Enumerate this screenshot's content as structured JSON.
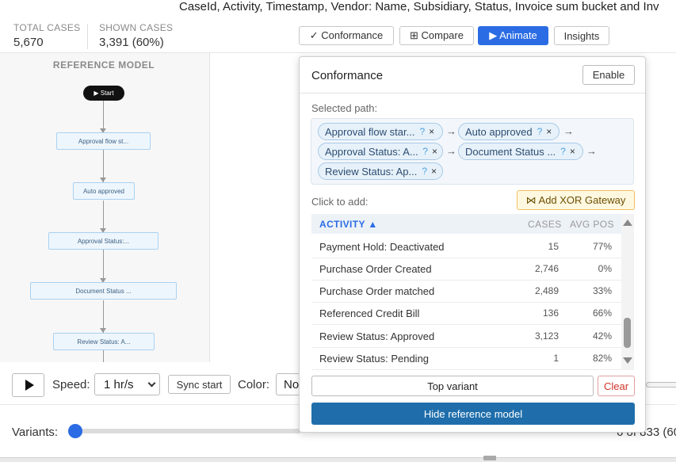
{
  "header": {
    "title": "CaseId, Activity, Timestamp, Vendor: Name, Subsidiary, Status, Invoice sum bucket and Inv",
    "total_cases_label": "TOTAL CASES",
    "total_cases_value": "5,670",
    "shown_cases_label": "SHOWN CASES",
    "shown_cases_value": "3,391 (60%)"
  },
  "toolbar": {
    "conformance_label": "✓ Conformance",
    "compare_label": "⊞ Compare",
    "animate_label": "▶ Animate",
    "insights_label": "Insights"
  },
  "reference_model": {
    "title": "REFERENCE MODEL",
    "start_label": "▶ Start",
    "nodes": [
      "Approval flow st...",
      "Auto approved",
      "Approval Status:...",
      "Document Status ...",
      "Review Status: A..."
    ]
  },
  "conformance": {
    "title": "Conformance",
    "enable_label": "Enable",
    "selected_path_label": "Selected path:",
    "chips": [
      "Approval flow star...",
      "Auto approved",
      "Approval Status: A...",
      "Document Status ...",
      "Review Status: Ap..."
    ],
    "chip_q": "?",
    "chip_x": "×",
    "arrow": "→",
    "click_to_add_label": "Click to add:",
    "xor_label": "⋈ Add XOR Gateway",
    "table": {
      "col_activity": "ACTIVITY ▲",
      "col_cases": "CASES",
      "col_avg_pos": "AVG POS",
      "rows": [
        {
          "name": "Payment Hold: Deactivated",
          "cases": "15",
          "avg": "77%"
        },
        {
          "name": "Purchase Order Created",
          "cases": "2,746",
          "avg": "0%"
        },
        {
          "name": "Purchase Order matched",
          "cases": "2,489",
          "avg": "33%"
        },
        {
          "name": "Referenced Credit Bill",
          "cases": "136",
          "avg": "66%"
        },
        {
          "name": "Review Status: Approved",
          "cases": "3,123",
          "avg": "42%"
        },
        {
          "name": "Review Status: Pending",
          "cases": "1",
          "avg": "82%"
        }
      ]
    },
    "top_variant_label": "Top variant",
    "clear_label": "Clear",
    "hide_reference_label": "Hide reference model"
  },
  "controls": {
    "speed_label": "Speed:",
    "speed_value": "1 hr/s",
    "sync_start_label": "Sync start",
    "color_label": "Color:",
    "color_value": "No",
    "variants_label": "Variants:",
    "variants_count": "6 of 833 (60"
  }
}
